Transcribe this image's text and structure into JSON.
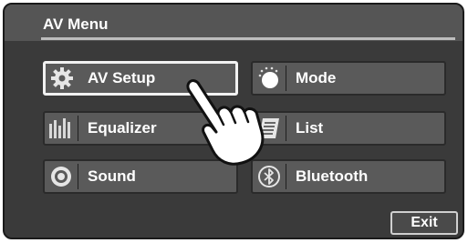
{
  "window": {
    "title": "AV Menu"
  },
  "menu": {
    "items": [
      {
        "label": "AV Setup",
        "icon": "gear-icon",
        "selected": true
      },
      {
        "label": "Equalizer",
        "icon": "equalizer-icon"
      },
      {
        "label": "Sound",
        "icon": "speaker-icon"
      },
      {
        "label": "Mode",
        "icon": "mode-dial-icon"
      },
      {
        "label": "List",
        "icon": "list-icon"
      },
      {
        "label": "Bluetooth",
        "icon": "bluetooth-icon"
      }
    ]
  },
  "footer": {
    "exit_label": "Exit"
  },
  "colors": {
    "background": "#3a3a3a",
    "button": "#5a5a5a",
    "title_bar": "#555555",
    "text": "#ffffff"
  }
}
